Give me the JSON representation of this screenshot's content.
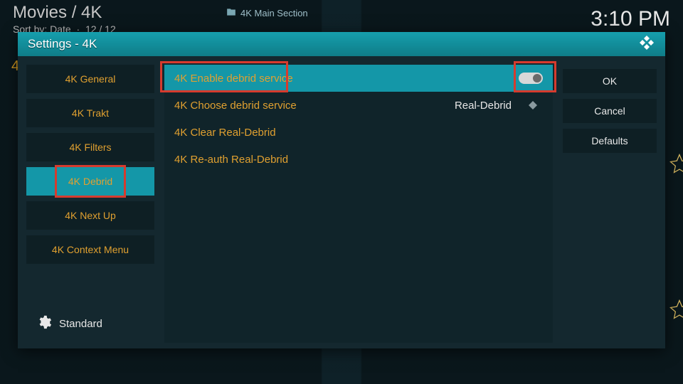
{
  "topbar": {
    "breadcrumb": "Movies / 4K",
    "sort_label": "Sort by: Date",
    "count": "12 / 12",
    "section_label": "4K Main Section",
    "clock": "3:10 PM"
  },
  "accent_text": "4",
  "dialog": {
    "title": "Settings - 4K"
  },
  "sidebar": {
    "items": [
      {
        "label": "4K General"
      },
      {
        "label": "4K Trakt"
      },
      {
        "label": "4K Filters"
      },
      {
        "label": "4K Debrid",
        "active": true,
        "highlight": true
      },
      {
        "label": "4K Next Up"
      },
      {
        "label": "4K Context Menu"
      }
    ],
    "level_label": "Standard"
  },
  "settings": {
    "rows": [
      {
        "label": "4K Enable debrid service",
        "type": "toggle",
        "value_on": true,
        "selected": true,
        "highlight": true
      },
      {
        "label": "4K Choose debrid service",
        "type": "select",
        "value": "Real-Debrid"
      },
      {
        "label": "4K Clear Real-Debrid",
        "type": "action"
      },
      {
        "label": "4K Re-auth Real-Debrid",
        "type": "action"
      }
    ]
  },
  "actions": {
    "ok": "OK",
    "cancel": "Cancel",
    "defaults": "Defaults"
  }
}
